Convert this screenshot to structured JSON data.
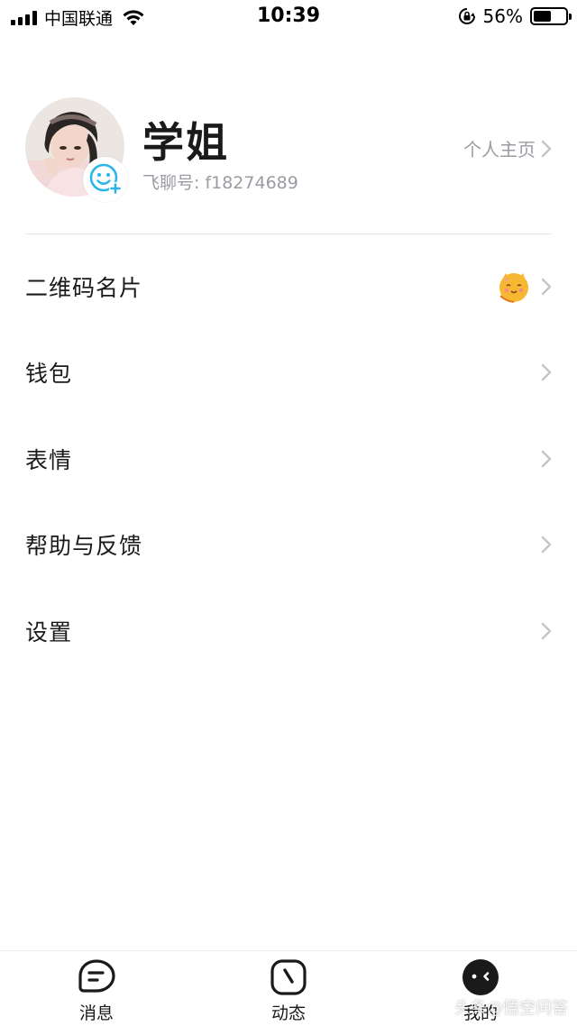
{
  "status_bar": {
    "carrier": "中国联通",
    "time": "10:39",
    "battery_percent": "56%",
    "battery_level": 0.56,
    "icons": [
      "signal-icon",
      "wifi-icon",
      "orientation-lock-icon",
      "battery-icon"
    ]
  },
  "profile": {
    "name": "学姐",
    "id_text": "飞聊号: f18274689",
    "homepage_label": "个人主页",
    "avatar_badge_icon": "add-emoji-icon"
  },
  "menu": {
    "items": [
      {
        "label": "二维码名片",
        "icon": "cat-sticker-icon"
      },
      {
        "label": "钱包"
      },
      {
        "label": "表情"
      },
      {
        "label": "帮助与反馈"
      },
      {
        "label": "设置"
      }
    ]
  },
  "tab_bar": {
    "tabs": [
      {
        "label": "消息",
        "icon": "chat-bubble-icon"
      },
      {
        "label": "动态",
        "icon": "compass-icon"
      },
      {
        "label": "我的",
        "icon": "face-icon",
        "active": true
      }
    ],
    "watermark": "头条@悟空问答"
  },
  "colors": {
    "accent": "#2bb5e8",
    "text_primary": "#1a1a1a",
    "text_secondary": "#9a9ca3",
    "chevron": "#c4c5ca"
  }
}
